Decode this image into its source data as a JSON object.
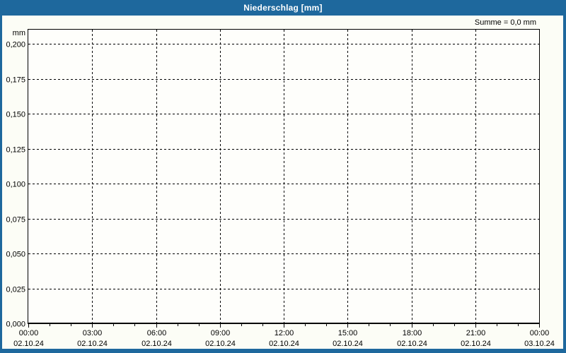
{
  "window": {
    "title": "Niederschlag [mm]"
  },
  "colors": {
    "titlebar": "#1e689d",
    "window_border": "#1e689d",
    "content_background": "#fcfdf6",
    "plot_background": "#fefefb",
    "grid": "#000000",
    "axis": "#000000",
    "text": "#000000",
    "title_text": "#ffffff"
  },
  "chart_data": {
    "type": "bar",
    "title": "Niederschlag [mm]",
    "unit": "mm",
    "ylabel": "mm",
    "ylim": [
      0.0,
      0.2
    ],
    "y_ticks": [
      0.0,
      0.025,
      0.05,
      0.075,
      0.1,
      0.125,
      0.15,
      0.175,
      0.2
    ],
    "y_tick_labels": [
      "0,000",
      "0,025",
      "0,050",
      "0,075",
      "0,100",
      "0,125",
      "0,150",
      "0,175",
      "0,200"
    ],
    "x_axis": {
      "range_hours": 24,
      "major_tick_interval_hours": 3,
      "minor_tick_interval_hours": 1,
      "major_ticks": [
        {
          "time": "00:00",
          "date": "02.10.24"
        },
        {
          "time": "03:00",
          "date": "02.10.24"
        },
        {
          "time": "06:00",
          "date": "02.10.24"
        },
        {
          "time": "09:00",
          "date": "02.10.24"
        },
        {
          "time": "12:00",
          "date": "02.10.24"
        },
        {
          "time": "15:00",
          "date": "02.10.24"
        },
        {
          "time": "18:00",
          "date": "02.10.24"
        },
        {
          "time": "21:00",
          "date": "02.10.24"
        },
        {
          "time": "00:00",
          "date": "03.10.24"
        }
      ]
    },
    "grid": {
      "style": "dashed",
      "horizontal": true,
      "vertical": true
    },
    "legend": "none",
    "series": [
      {
        "name": "Niederschlag",
        "values": []
      }
    ],
    "sum_value_mm": 0.0,
    "sum_annotation": "Summe = 0,0 mm"
  }
}
